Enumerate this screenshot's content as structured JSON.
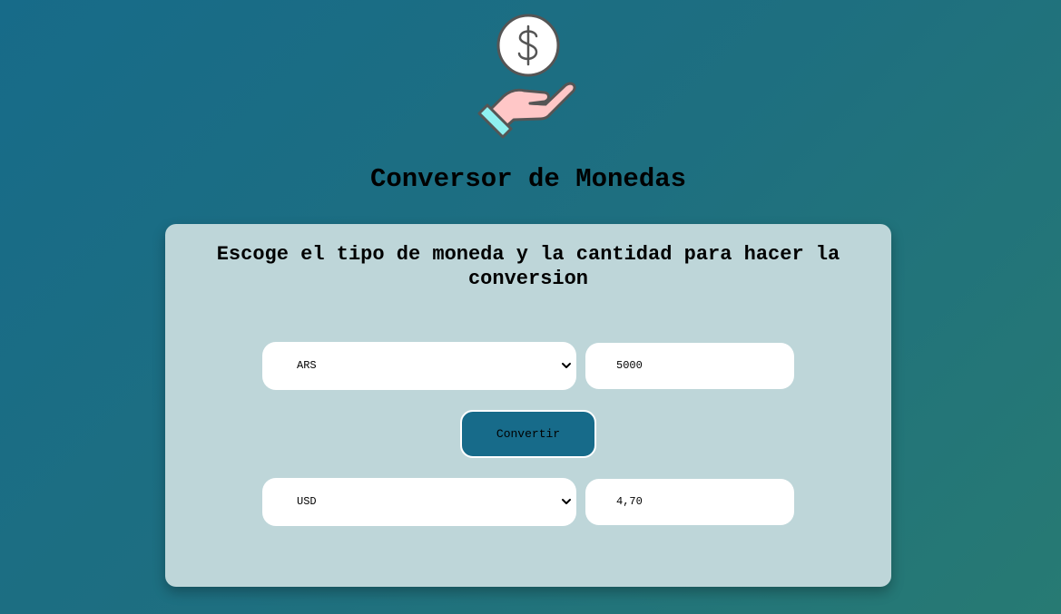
{
  "header": {
    "logo_icon": "hand-holding-dollar-icon",
    "title": "Conversor de Monedas"
  },
  "card": {
    "subtitle": "Escoge el tipo de moneda y la cantidad para hacer la conversion",
    "from": {
      "currency": "ARS",
      "amount": "5000"
    },
    "convert_button": "Convertir",
    "to": {
      "currency": "USD",
      "amount": "4,70"
    }
  },
  "colors": {
    "background_start": "#176b89",
    "background_end": "#277a73",
    "card": "#bed6d9",
    "button": "#176b8a",
    "hand": "#ffc7c7",
    "cuff": "#8ff0f0"
  }
}
